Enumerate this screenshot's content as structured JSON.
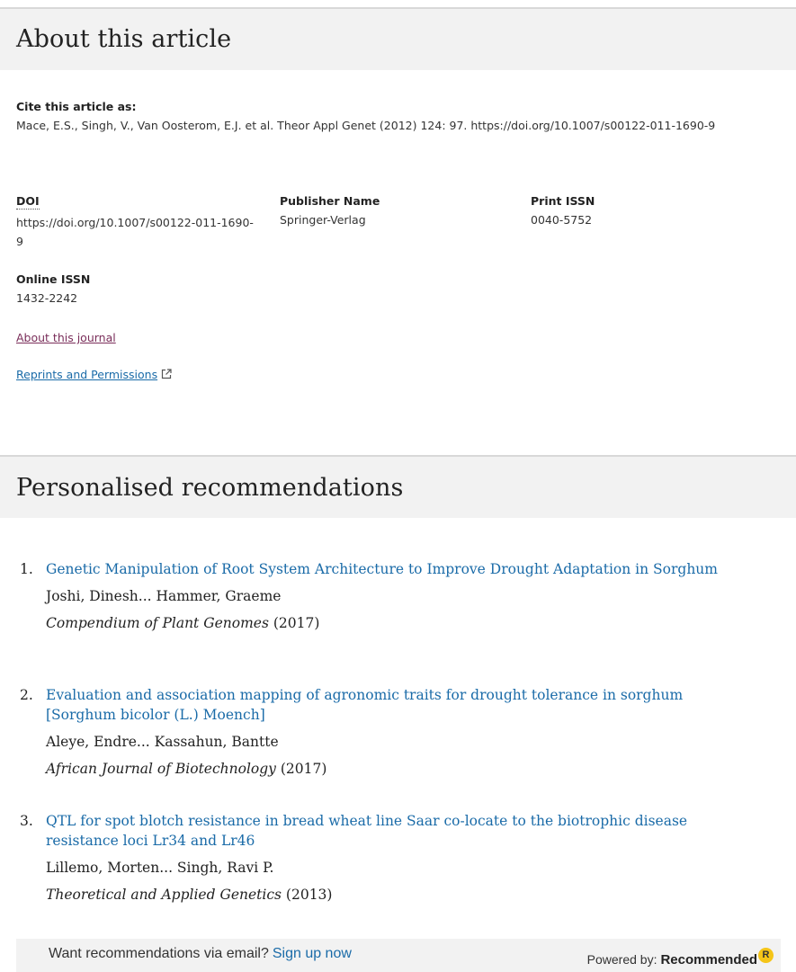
{
  "about": {
    "heading": "About this article",
    "cite_label": "Cite this article as:",
    "cite_text": "Mace, E.S., Singh, V., Van Oosterom, E.J. et al. Theor Appl Genet (2012) 124: 97. https://doi.org/10.1007/s00122-011-1690-9",
    "doi_label": "DOI",
    "doi_value": "https://doi.org/10.1007/s00122-011-1690-9",
    "publisher_label": "Publisher Name",
    "publisher_value": "Springer-Verlag",
    "print_issn_label": "Print ISSN",
    "print_issn_value": "0040-5752",
    "online_issn_label": "Online ISSN",
    "online_issn_value": "1432-2242",
    "journal_link": "About this journal",
    "reprints_link": "Reprints and Permissions"
  },
  "recommendations": {
    "heading": "Personalised recommendations",
    "items": [
      {
        "number": "1.",
        "title": "Genetic Manipulation of Root System Architecture to Improve Drought Adaptation in Sorghum",
        "authors": "Joshi, Dinesh... Hammer, Graeme",
        "journal": "Compendium of Plant Genomes",
        "year": "(2017)"
      },
      {
        "number": "2.",
        "title": "Evaluation and association mapping of agronomic traits for drought tolerance in sorghum [Sorghum bicolor (L.) Moench]",
        "authors": "Aleye, Endre... Kassahun, Bantte",
        "journal": "African Journal of Biotechnology",
        "year": "(2017)"
      },
      {
        "number": "3.",
        "title": "QTL for spot blotch resistance in bread wheat line Saar co-locate to the biotrophic disease resistance loci Lr34 and Lr46",
        "authors": "Lillemo, Morten... Singh, Ravi P.",
        "journal": "Theoretical and Applied Genetics",
        "year": "(2013)"
      }
    ],
    "footer_prompt": "Want recommendations via email?",
    "signup_link": "Sign up now",
    "powered_by_label": "Powered by:",
    "powered_by_brand": "Recommended",
    "brand_badge": "R"
  },
  "colors": {
    "link_blue": "#1a6ba8",
    "visited_link": "#7a2e5a",
    "header_bg": "#f2f2f2",
    "badge_yellow": "#f5c518"
  },
  "icons": {
    "reprints": "external-link-icon",
    "brand": "recommended-logo-icon"
  }
}
